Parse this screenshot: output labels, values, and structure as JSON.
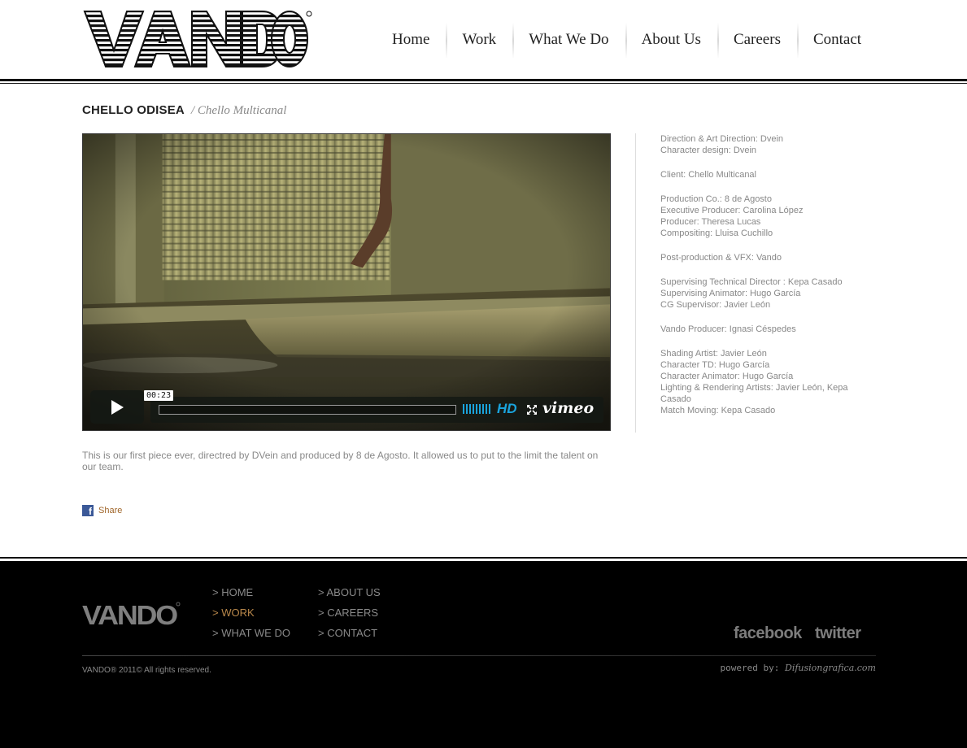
{
  "header": {
    "logo_text": "VANDO",
    "nav": [
      {
        "label": "Home"
      },
      {
        "label": "Work"
      },
      {
        "label": "What We Do"
      },
      {
        "label": "About Us"
      },
      {
        "label": "Careers"
      },
      {
        "label": "Contact"
      }
    ]
  },
  "project": {
    "title": "CHELLO ODISEA",
    "client": "/ Chello Multicanal",
    "description": "This is our first piece ever, directred by DVein and produced by 8 de Agosto. It allowed us to put to the limit the talent on our team.",
    "share_label": "Share"
  },
  "player": {
    "time": "00:23",
    "hd_label": "HD",
    "brand": "vimeo",
    "volume_icon": "volume-bars-icon",
    "fullscreen_icon": "fullscreen-icon",
    "play_icon": "play-icon"
  },
  "credits": [
    [
      "Direction & Art Direction: Dvein",
      "Character design: Dvein"
    ],
    [
      "Client: Chello Multicanal"
    ],
    [
      "Production Co.: 8 de Agosto",
      "Executive Producer: Carolina López",
      "Producer: Theresa Lucas",
      "Compositing: Lluisa Cuchillo"
    ],
    [
      "Post-production & VFX: Vando"
    ],
    [
      "Supervising Technical Director : Kepa Casado",
      "Supervising Animator: Hugo García",
      "CG Supervisor: Javier León"
    ],
    [
      "Vando Producer: Ignasi Céspedes"
    ],
    [
      "Shading Artist: Javier León",
      "Character TD: Hugo García",
      "Character Animator: Hugo García",
      "Lighting & Rendering Artists: Javier León, Kepa Casado",
      "Match Moving: Kepa Casado"
    ]
  ],
  "footer": {
    "logo_text": "VANDO",
    "links_col1": [
      {
        "label": "> HOME",
        "active": false
      },
      {
        "label": "> WORK",
        "active": true
      },
      {
        "label": "> WHAT WE DO",
        "active": false
      }
    ],
    "links_col2": [
      {
        "label": "> ABOUT US",
        "active": false
      },
      {
        "label": "> CAREERS",
        "active": false
      },
      {
        "label": "> CONTACT",
        "active": false
      }
    ],
    "social": {
      "facebook": "facebook",
      "twitter": "twitter"
    },
    "copyright": "VANDO® 2011© All rights reserved.",
    "powered_prefix": "powered by:",
    "powered_name": "Difusiongrafica.com"
  },
  "colors": {
    "accent_orange": "#b8874a",
    "share_color": "#a0662a",
    "vimeo_blue": "#1aa3dc",
    "facebook_blue": "#3b5998"
  }
}
